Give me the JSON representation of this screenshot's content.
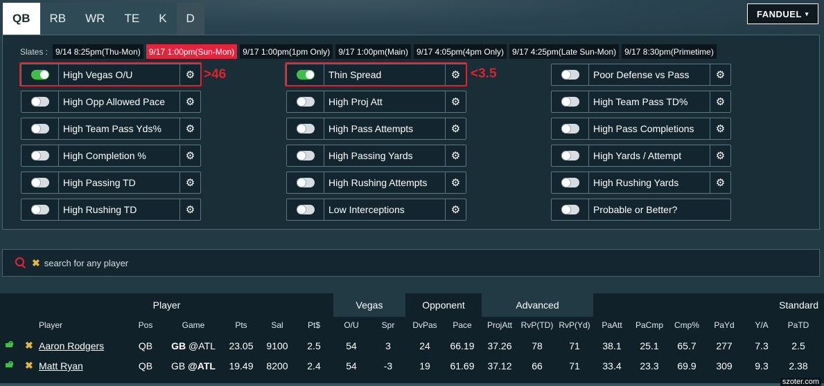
{
  "tabs": [
    "QB",
    "RB",
    "WR",
    "TE",
    "K",
    "D"
  ],
  "brand": {
    "label": "FANDUEL",
    "caret": "▾"
  },
  "slates": {
    "label": "Slates :",
    "items": [
      "9/14 8:25pm(Thu-Mon)",
      "9/17 1:00pm(Sun-Mon)",
      "9/17 1:00pm(1pm Only)",
      "9/17 1:00pm(Main)",
      "9/17 4:05pm(4pm Only)",
      "9/17 4:25pm(Late Sun-Mon)",
      "9/17 8:30pm(Primetime)"
    ],
    "active_index": 1
  },
  "filters": {
    "col1": [
      {
        "label": "High Vegas O/U",
        "on": true
      },
      {
        "label": "High Opp Allowed Pace",
        "on": false
      },
      {
        "label": "High Team Pass Yds%",
        "on": false
      },
      {
        "label": "High Completion %",
        "on": false
      },
      {
        "label": "High Passing TD",
        "on": false
      },
      {
        "label": "High Rushing TD",
        "on": false
      }
    ],
    "col2": [
      {
        "label": "Thin Spread",
        "on": true
      },
      {
        "label": "High Proj Att",
        "on": false
      },
      {
        "label": "High Pass Attempts",
        "on": false
      },
      {
        "label": "High Passing Yards",
        "on": false
      },
      {
        "label": "High Rushing Attempts",
        "on": false
      },
      {
        "label": "Low Interceptions",
        "on": false
      }
    ],
    "col3": [
      {
        "label": "Poor Defense vs Pass",
        "on": false
      },
      {
        "label": "High Team Pass TD%",
        "on": false
      },
      {
        "label": "High Pass Completions",
        "on": false
      },
      {
        "label": "High Yards / Attempt",
        "on": false
      },
      {
        "label": "High Rushing Yards",
        "on": false
      },
      {
        "label": "Probable or Better?",
        "on": false
      }
    ]
  },
  "annotations": {
    "vegas": ">46",
    "spread": "<3.5"
  },
  "search": {
    "placeholder": "search for any player"
  },
  "table": {
    "groups": [
      "Player",
      "Vegas",
      "Opponent",
      "Advanced",
      "Standard"
    ],
    "columns": [
      "Player",
      "Pos",
      "Game",
      "Pts",
      "Sal",
      "Pt$",
      "O/U",
      "Spr",
      "DvPas",
      "Pace",
      "ProjAtt",
      "RvP(TD)",
      "RvP(Yd)",
      "PaAtt",
      "PaCmp",
      "Cmp%",
      "PaYd",
      "Y/A",
      "PaTD"
    ],
    "rows": [
      {
        "name": "Aaron Rodgers",
        "pos": "QB",
        "team": "GB",
        "opp": "@ATL",
        "bold": "team",
        "vals": [
          "23.05",
          "9100",
          "2.5",
          "54",
          "3",
          "24",
          "66.19",
          "37.26",
          "78",
          "71",
          "38.1",
          "25.1",
          "65.7",
          "277",
          "7.3",
          "2.5"
        ]
      },
      {
        "name": "Matt Ryan",
        "pos": "QB",
        "team": "GB",
        "opp": "@ATL",
        "bold": "opp",
        "vals": [
          "19.49",
          "8200",
          "2.4",
          "54",
          "-3",
          "19",
          "61.69",
          "37.12",
          "66",
          "71",
          "33.4",
          "23.3",
          "69.9",
          "309",
          "9.3",
          "2.38"
        ]
      }
    ]
  },
  "watermark": "szoter.com"
}
